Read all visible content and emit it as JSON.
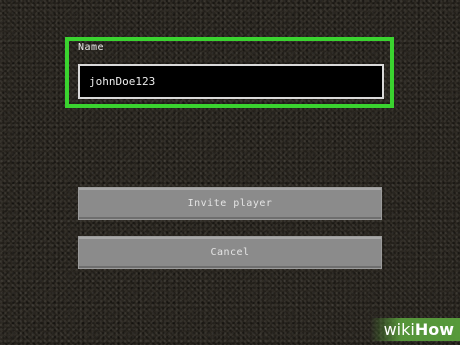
{
  "form": {
    "name_label": "Name",
    "name_value": "johnDoe123",
    "highlight_color": "#3ad32f"
  },
  "buttons": {
    "invite_label": "Invite player",
    "cancel_label": "Cancel"
  },
  "watermark": {
    "wiki": "wiki",
    "how": "How"
  }
}
